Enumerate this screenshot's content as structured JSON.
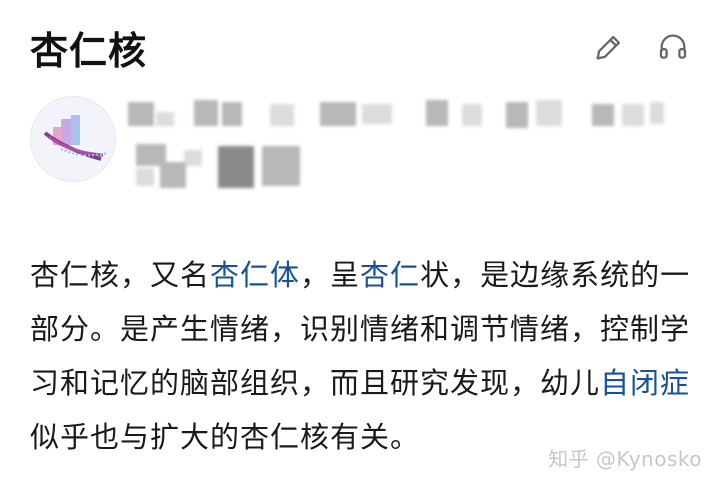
{
  "header": {
    "title": "杏仁核"
  },
  "icons": {
    "edit": "pencil-icon",
    "listen": "headphones-icon"
  },
  "content": {
    "p1": "杏仁核，又名",
    "link1": "杏仁体",
    "p2": "，呈",
    "link2": "杏仁",
    "p3": "状，是边缘系统的一部分。是产生情绪，识别情绪和调节情绪，控制学习和记忆的脑部组织，而且研究发现，幼儿",
    "link3": "自闭症",
    "p4": "似乎也与扩大的杏仁核有关。"
  },
  "watermark": {
    "text": "知乎 @Kynosko"
  },
  "colors": {
    "link": "#175199",
    "text": "#1a1a1a",
    "watermark": "#c7c7c7"
  }
}
